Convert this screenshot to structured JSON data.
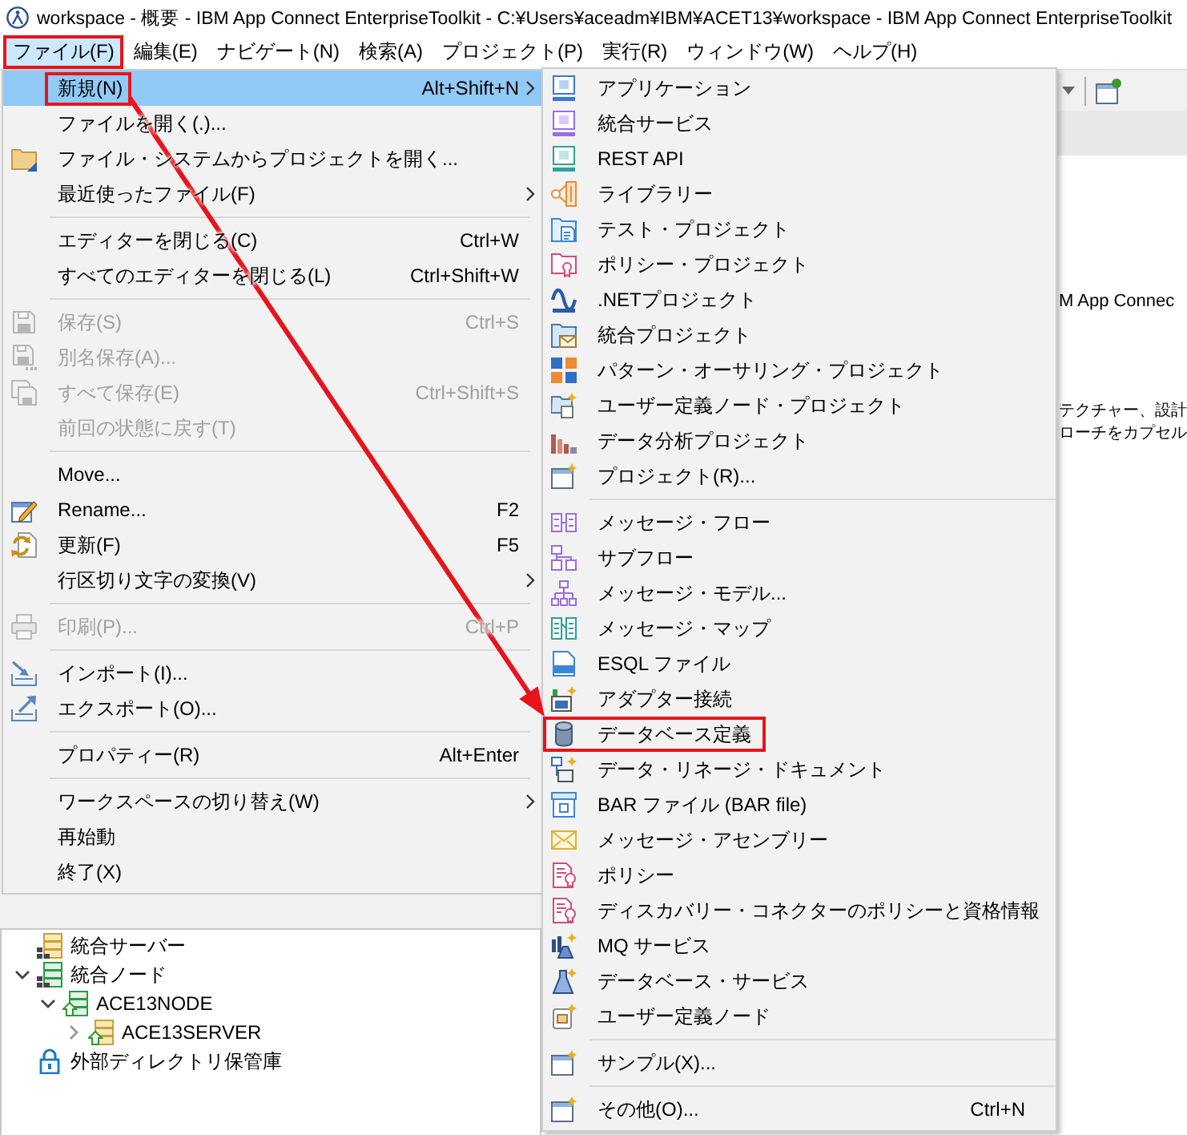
{
  "window": {
    "title": "workspace - 概要 - IBM App Connect EnterpriseToolkit - C:¥Users¥aceadm¥IBM¥ACET13¥workspace - IBM App Connect EnterpriseToolkit"
  },
  "menu_bar": [
    {
      "label": "ファイル(F)",
      "selected": true,
      "annotated": true
    },
    {
      "label": "編集(E)",
      "selected": false,
      "annotated": false
    },
    {
      "label": "ナビゲート(N)",
      "selected": false,
      "annotated": false
    },
    {
      "label": "検索(A)",
      "selected": false,
      "annotated": false
    },
    {
      "label": "プロジェクト(P)",
      "selected": false,
      "annotated": false
    },
    {
      "label": "実行(R)",
      "selected": false,
      "annotated": false
    },
    {
      "label": "ウィンドウ(W)",
      "selected": false,
      "annotated": false
    },
    {
      "label": "ヘルプ(H)",
      "selected": false,
      "annotated": false
    }
  ],
  "file_menu": {
    "items": [
      {
        "kind": "item",
        "label": "新規(N)",
        "shortcut": "Alt+Shift+N",
        "has_submenu": true,
        "selected": true,
        "disabled": false,
        "annotated": true
      },
      {
        "kind": "item",
        "label": "ファイルを開く(.)...",
        "has_submenu": false,
        "selected": false,
        "disabled": false,
        "annotated": false
      },
      {
        "kind": "item",
        "label": "ファイル・システムからプロジェクトを開く...",
        "has_submenu": false,
        "selected": false,
        "disabled": false,
        "annotated": false
      },
      {
        "kind": "item",
        "label": "最近使ったファイル(F)",
        "has_submenu": true,
        "selected": false,
        "disabled": false,
        "annotated": false
      },
      {
        "kind": "separator"
      },
      {
        "kind": "item",
        "label": "エディターを閉じる(C)",
        "shortcut": "Ctrl+W",
        "has_submenu": false,
        "selected": false,
        "disabled": false,
        "annotated": false
      },
      {
        "kind": "item",
        "label": "すべてのエディターを閉じる(L)",
        "shortcut": "Ctrl+Shift+W",
        "has_submenu": false,
        "selected": false,
        "disabled": false,
        "annotated": false
      },
      {
        "kind": "separator"
      },
      {
        "kind": "item",
        "label": "保存(S)",
        "shortcut": "Ctrl+S",
        "has_submenu": false,
        "selected": false,
        "disabled": true,
        "annotated": false
      },
      {
        "kind": "item",
        "label": "別名保存(A)...",
        "has_submenu": false,
        "selected": false,
        "disabled": true,
        "annotated": false
      },
      {
        "kind": "item",
        "label": "すべて保存(E)",
        "shortcut": "Ctrl+Shift+S",
        "has_submenu": false,
        "selected": false,
        "disabled": true,
        "annotated": false
      },
      {
        "kind": "item",
        "label": "前回の状態に戻す(T)",
        "has_submenu": false,
        "selected": false,
        "disabled": true,
        "annotated": false
      },
      {
        "kind": "separator"
      },
      {
        "kind": "item",
        "label": "Move...",
        "has_submenu": false,
        "selected": false,
        "disabled": false,
        "annotated": false
      },
      {
        "kind": "item",
        "label": "Rename...",
        "shortcut": "F2",
        "has_submenu": false,
        "selected": false,
        "disabled": false,
        "annotated": false
      },
      {
        "kind": "item",
        "label": "更新(F)",
        "shortcut": "F5",
        "has_submenu": false,
        "selected": false,
        "disabled": false,
        "annotated": false
      },
      {
        "kind": "item",
        "label": "行区切り文字の変換(V)",
        "has_submenu": true,
        "selected": false,
        "disabled": false,
        "annotated": false
      },
      {
        "kind": "separator"
      },
      {
        "kind": "item",
        "label": "印刷(P)...",
        "shortcut": "Ctrl+P",
        "has_submenu": false,
        "selected": false,
        "disabled": true,
        "annotated": false
      },
      {
        "kind": "separator"
      },
      {
        "kind": "item",
        "label": "インポート(I)...",
        "has_submenu": false,
        "selected": false,
        "disabled": false,
        "annotated": false
      },
      {
        "kind": "item",
        "label": "エクスポート(O)...",
        "has_submenu": false,
        "selected": false,
        "disabled": false,
        "annotated": false
      },
      {
        "kind": "separator"
      },
      {
        "kind": "item",
        "label": "プロパティー(R)",
        "shortcut": "Alt+Enter",
        "has_submenu": false,
        "selected": false,
        "disabled": false,
        "annotated": false
      },
      {
        "kind": "separator"
      },
      {
        "kind": "item",
        "label": "ワークスペースの切り替え(W)",
        "has_submenu": true,
        "selected": false,
        "disabled": false,
        "annotated": false
      },
      {
        "kind": "item",
        "label": "再始動",
        "has_submenu": false,
        "selected": false,
        "disabled": false,
        "annotated": false
      },
      {
        "kind": "item",
        "label": "終了(X)",
        "has_submenu": false,
        "selected": false,
        "disabled": false,
        "annotated": false
      }
    ]
  },
  "new_submenu": {
    "items": [
      {
        "kind": "item",
        "label": "アプリケーション",
        "annotated": false
      },
      {
        "kind": "item",
        "label": "統合サービス",
        "annotated": false
      },
      {
        "kind": "item",
        "label": "REST API",
        "annotated": false
      },
      {
        "kind": "item",
        "label": "ライブラリー",
        "annotated": false
      },
      {
        "kind": "item",
        "label": "テスト・プロジェクト",
        "annotated": false
      },
      {
        "kind": "item",
        "label": "ポリシー・プロジェクト",
        "annotated": false
      },
      {
        "kind": "item",
        "label": ".NETプロジェクト",
        "annotated": false
      },
      {
        "kind": "item",
        "label": "統合プロジェクト",
        "annotated": false
      },
      {
        "kind": "item",
        "label": "パターン・オーサリング・プロジェクト",
        "annotated": false
      },
      {
        "kind": "item",
        "label": "ユーザー定義ノード・プロジェクト",
        "annotated": false
      },
      {
        "kind": "item",
        "label": "データ分析プロジェクト",
        "annotated": false
      },
      {
        "kind": "item",
        "label": "プロジェクト(R)...",
        "annotated": false
      },
      {
        "kind": "separator"
      },
      {
        "kind": "item",
        "label": "メッセージ・フロー",
        "annotated": false
      },
      {
        "kind": "item",
        "label": "サブフロー",
        "annotated": false
      },
      {
        "kind": "item",
        "label": "メッセージ・モデル...",
        "annotated": false
      },
      {
        "kind": "item",
        "label": "メッセージ・マップ",
        "annotated": false
      },
      {
        "kind": "item",
        "label": "ESQL ファイル",
        "annotated": false
      },
      {
        "kind": "item",
        "label": "アダプター接続",
        "annotated": false
      },
      {
        "kind": "item",
        "label": "データベース定義",
        "annotated": true
      },
      {
        "kind": "item",
        "label": "データ・リネージ・ドキュメント",
        "annotated": false
      },
      {
        "kind": "item",
        "label": "BAR ファイル (BAR file)",
        "annotated": false
      },
      {
        "kind": "item",
        "label": "メッセージ・アセンブリー",
        "annotated": false
      },
      {
        "kind": "item",
        "label": "ポリシー",
        "annotated": false
      },
      {
        "kind": "item",
        "label": "ディスカバリー・コネクターのポリシーと資格情報",
        "annotated": false
      },
      {
        "kind": "item",
        "label": "MQ サービス",
        "annotated": false
      },
      {
        "kind": "item",
        "label": "データベース・サービス",
        "annotated": false
      },
      {
        "kind": "item",
        "label": "ユーザー定義ノード",
        "annotated": false
      },
      {
        "kind": "separator"
      },
      {
        "kind": "item",
        "label": "サンプル(X)...",
        "annotated": false
      },
      {
        "kind": "separator"
      },
      {
        "kind": "item",
        "label": "その他(O)...",
        "shortcut": "Ctrl+N",
        "annotated": false
      }
    ]
  },
  "editor": {
    "paragraphs": [
      [
        "M App Connec"
      ],
      [
        "テクチャー、設計",
        "ローチをカプセル"
      ]
    ]
  },
  "tree": [
    {
      "label": "統合サーバー"
    },
    {
      "label": "統合ノード",
      "expanded": true,
      "children": [
        {
          "label": "ACE13NODE",
          "expanded": true,
          "children": [
            {
              "label": "ACE13SERVER",
              "expanded": false
            }
          ]
        }
      ]
    },
    {
      "label": "外部ディレクトリ保管庫"
    }
  ],
  "callout_arrow": true
}
